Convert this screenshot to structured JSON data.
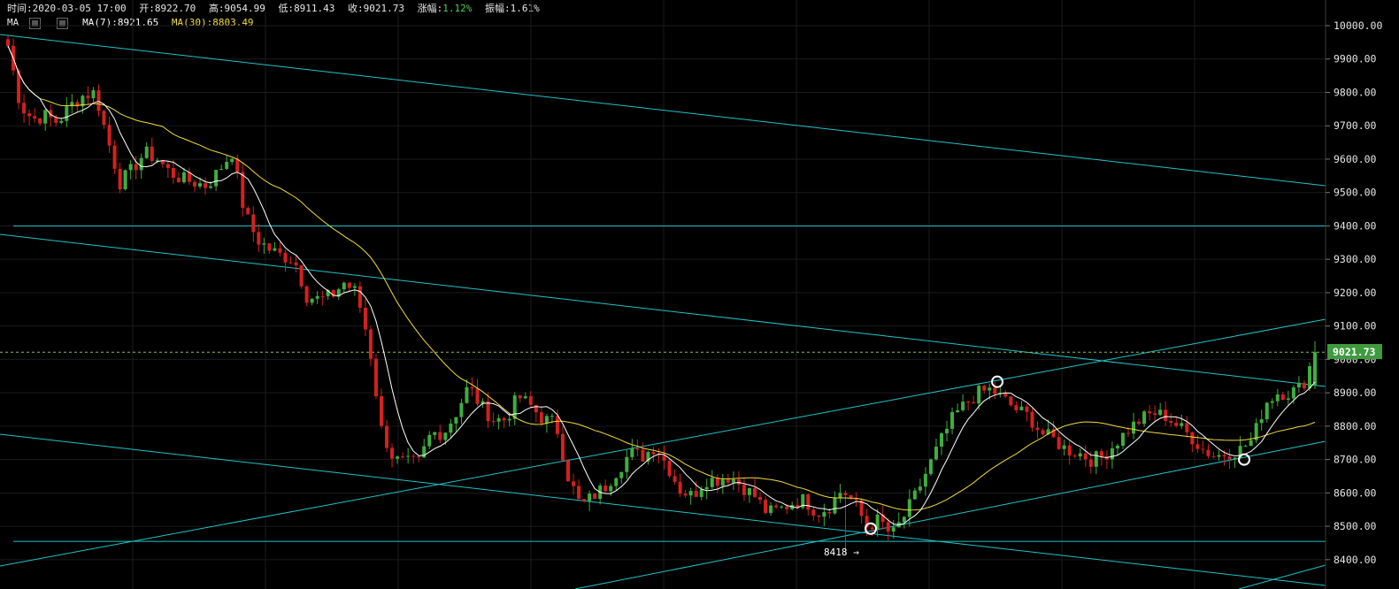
{
  "info_bar": {
    "time_label": "时间:",
    "time": "2020-03-05 17:00",
    "open_label": "开:",
    "open": "8922.70",
    "high_label": "高:",
    "high": "9054.99",
    "low_label": "低:",
    "low": "8911.43",
    "close_label": "收:",
    "close": "9021.73",
    "change_label": "涨幅:",
    "change": "1.12%",
    "amplitude_label": "振幅:",
    "amplitude": "1.61%"
  },
  "ma_bar": {
    "label": "MA",
    "ma7": "MA(7):8921.65",
    "ma30": "MA(30):8803.49",
    "ma7_color": "#ffffff",
    "ma30_color": "#f0dc3c"
  },
  "colors": {
    "background": "#000000",
    "up": "#3fae3f",
    "down": "#d42020",
    "trendline": "#22c3c6",
    "grid": "#1b1b1b",
    "price_label_bg": "#3e9b3e",
    "change_color": "#4cd64c"
  },
  "annotations": {
    "low_marker": "8418 →",
    "last_price": "9021.73"
  },
  "chart_data": {
    "type": "candlestick",
    "title": "",
    "symbol_interval": "1h",
    "y_axis": {
      "position": "right",
      "ticks": [
        "8400.00",
        "8500.00",
        "8600.00",
        "8700.00",
        "8800.00",
        "8900.00",
        "9000.00",
        "9100.00",
        "9200.00",
        "9300.00",
        "9400.00",
        "9500.00",
        "9600.00",
        "9700.00",
        "9800.00",
        "9900.00",
        "10000.00"
      ],
      "ylim": [
        8345,
        10055
      ]
    },
    "grid": true,
    "series": [
      {
        "name": "MA(7)",
        "last_value": 8921.65
      },
      {
        "name": "MA(30)",
        "last_value": 8803.49
      }
    ],
    "ohlc_anchor_closes": [
      9940,
      9760,
      9720,
      9730,
      9710,
      9760,
      9790,
      9800,
      9660,
      9530,
      9570,
      9620,
      9600,
      9560,
      9540,
      9530,
      9520,
      9570,
      9620,
      9440,
      9360,
      9330,
      9310,
      9300,
      9190,
      9180,
      9190,
      9230,
      9200,
      9050,
      8790,
      8700,
      8690,
      8690,
      8780,
      8780,
      8840,
      8920,
      8860,
      8820,
      8820,
      8890,
      8860,
      8820,
      8810,
      8650,
      8560,
      8590,
      8620,
      8670,
      8720,
      8710,
      8740,
      8680,
      8610,
      8590,
      8640,
      8640,
      8650,
      8620,
      8590,
      8540,
      8550,
      8570,
      8580,
      8540,
      8560,
      8610,
      8570,
      8500,
      8520,
      8470,
      8530,
      8600,
      8680,
      8760,
      8830,
      8870,
      8900,
      8910,
      8880,
      8850,
      8830,
      8780,
      8760,
      8730,
      8720,
      8700,
      8710,
      8750,
      8790,
      8820,
      8840,
      8830,
      8800,
      8770,
      8730,
      8710,
      8720,
      8730,
      8760,
      8870,
      8900,
      8900,
      8920,
      9021.73
    ],
    "last": {
      "time": "2020-03-05 17:00",
      "open": 8922.7,
      "high": 9054.99,
      "low": 8911.43,
      "close": 9021.73
    },
    "marked_low": 8418,
    "horizontal_lines": [
      9400,
      8455
    ],
    "touch_points": [
      {
        "price": 8933
      },
      {
        "price": 8493
      },
      {
        "price": 8700
      }
    ]
  }
}
